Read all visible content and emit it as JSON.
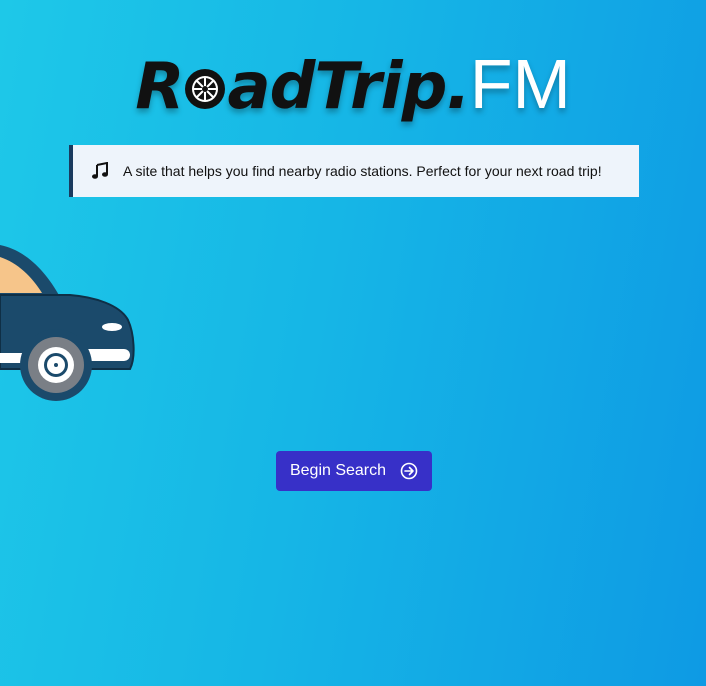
{
  "app": {
    "logo_part1_prefix": "R",
    "logo_part1_suffix": "adTrip.",
    "logo_part2": "FM"
  },
  "tagline": {
    "icon": "music-note-icon",
    "text": "A site that helps you find nearby radio stations. Perfect for your next road trip!"
  },
  "illustration": {
    "icon": "car-icon"
  },
  "cta": {
    "label": "Begin Search",
    "icon": "arrow-right-circle-icon",
    "color": "#3730c8"
  },
  "colors": {
    "background_start": "#1ec8e8",
    "background_end": "#0e9ae4",
    "tagline_bg": "#eef4fb",
    "tagline_border": "#1a3a5e"
  }
}
